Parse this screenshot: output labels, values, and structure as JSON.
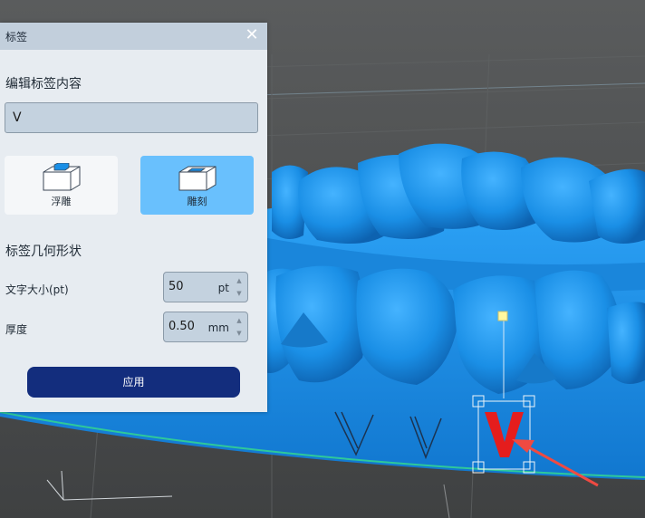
{
  "panel": {
    "title": "标签",
    "close_glyph": "✕",
    "edit_section_title": "编辑标签内容",
    "label_text": "V",
    "modes": [
      {
        "label": "浮雕",
        "icon": "emboss-icon",
        "selected": false
      },
      {
        "label": "雕刻",
        "icon": "engrave-icon",
        "selected": true
      }
    ],
    "geometry_section_title": "标签几何形状",
    "font_size": {
      "label": "文字大小(pt)",
      "value": "50",
      "unit": "pt"
    },
    "thickness": {
      "label": "厚度",
      "value": "0.50",
      "unit": "mm"
    },
    "apply_label": "应用"
  },
  "viewport": {
    "label_glyph": "V",
    "engraved_glyphs": [
      "V",
      "V"
    ],
    "colors": {
      "model": "#1a8fe6",
      "selected_label": "#e51d1d",
      "arrow": "#ef4a42",
      "handle": "#fff8a0",
      "panel_bg": "#e7ecf1",
      "accent": "#69c0fd",
      "primary_button": "#132d7d"
    }
  }
}
